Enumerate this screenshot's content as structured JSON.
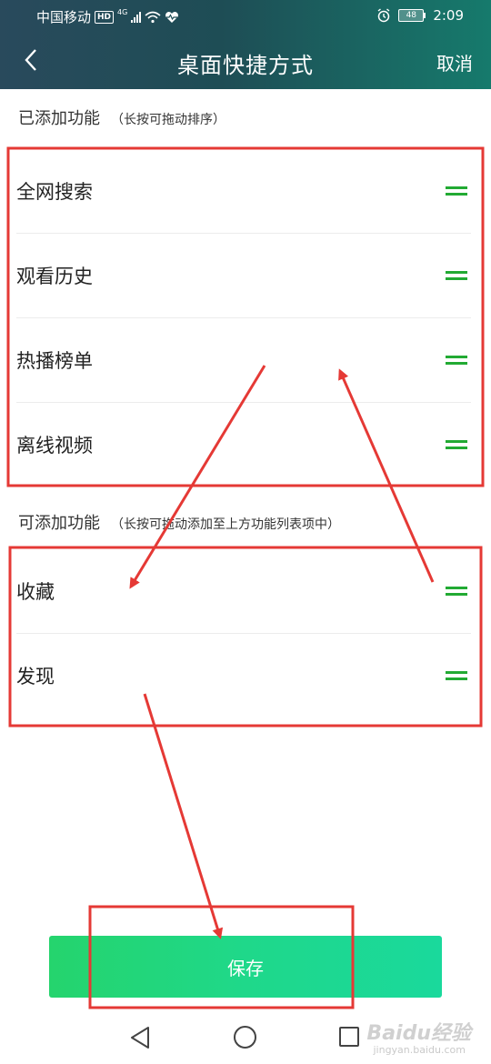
{
  "status_bar": {
    "carrier": "中国移动",
    "hd_badge": "HD",
    "network_badge": "4G",
    "battery": "48",
    "time": "2:09"
  },
  "header": {
    "title": "桌面快捷方式",
    "cancel_label": "取消"
  },
  "added_section": {
    "title": "已添加功能",
    "hint": "（长按可拖动排序）",
    "items": [
      {
        "label": "全网搜索"
      },
      {
        "label": "观看历史"
      },
      {
        "label": "热播榜单"
      },
      {
        "label": "离线视频"
      }
    ]
  },
  "available_section": {
    "title": "可添加功能",
    "hint": "（长按可拖动添加至上方功能列表项中）",
    "items": [
      {
        "label": "收藏"
      },
      {
        "label": "发现"
      }
    ]
  },
  "save_label": "保存",
  "watermark": {
    "text": "Baidu经验",
    "sub": "jingyan.baidu.com"
  },
  "colors": {
    "header_start": "#294a5c",
    "header_end": "#167a6c",
    "drag_handle": "#22aa33",
    "save_button": "#1fd88a",
    "annotation": "#e53935"
  }
}
